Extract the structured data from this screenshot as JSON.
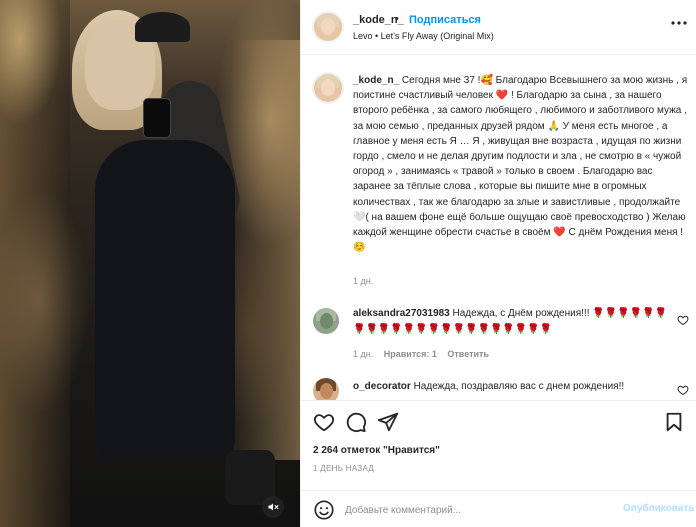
{
  "media": {
    "mute_icon": "speaker-muted-icon"
  },
  "header": {
    "username": "_kode_n_",
    "dot": "•",
    "follow_label": "Подписаться",
    "audio": "Levo • Let's Fly Away (Original Mix)",
    "more_icon": "more-horizontal-icon"
  },
  "caption": {
    "username": "_kode_n_",
    "text": " Сегодня мне 37 !🥰 Благодарю Всевышнего за мою жизнь , я поистине счастливый человек ❤️ ! Благодарю за сына , за нашего второго ребёнка , за самого любящего , любимого и заботливого мужа , за мою семью , преданных друзей рядом 🙏 У меня есть многое , а главное у меня есть Я … Я , живущая вне возраста , идущая по жизни гордо , смело и не делая другим подлости и зла , не смотрю в « чужой огород » , занимаясь « травой » только в своем . Благодарю вас заранее за тёплые слова , которые вы пишите мне в огромных количествах , так же благодарю за злые и завистливые , продолжайте 🤍( на вашем фоне ещё больше ощущаю своё превосходство ) Желаю каждой женщине обрести счастье в своём ❤️ С днём Рождения меня !☺️",
    "age": "1 дн."
  },
  "comments": [
    {
      "username": "aleksandra27031983",
      "text": " Надежда, с Днём рождения!!! 🌹🌹🌹🌹🌹🌹🌹🌹🌹🌹🌹🌹🌹🌹🌹🌹🌹🌹🌹🌹🌹🌹",
      "age": "1 дн.",
      "likes": "Нравится: 1",
      "reply": "Ответить"
    },
    {
      "username": "o_decorator",
      "text": " Надежда, поздравляю вас с днем рождения!!"
    }
  ],
  "actions": {
    "like_icon": "heart-icon",
    "comment_icon": "comment-icon",
    "share_icon": "paper-plane-icon",
    "save_icon": "bookmark-icon",
    "likes_count": "2 264 отметок \"Нравится\"",
    "post_age": "1 ДЕНЬ НАЗАД"
  },
  "add_comment": {
    "emoji_icon": "smiley-icon",
    "placeholder": "Добавьте комментарий...",
    "publish_label": "Опубликовать"
  },
  "colors": {
    "accent": "#0095f6",
    "publish_disabled": "#b2dffc",
    "secondary_text": "#8e8e8e"
  }
}
